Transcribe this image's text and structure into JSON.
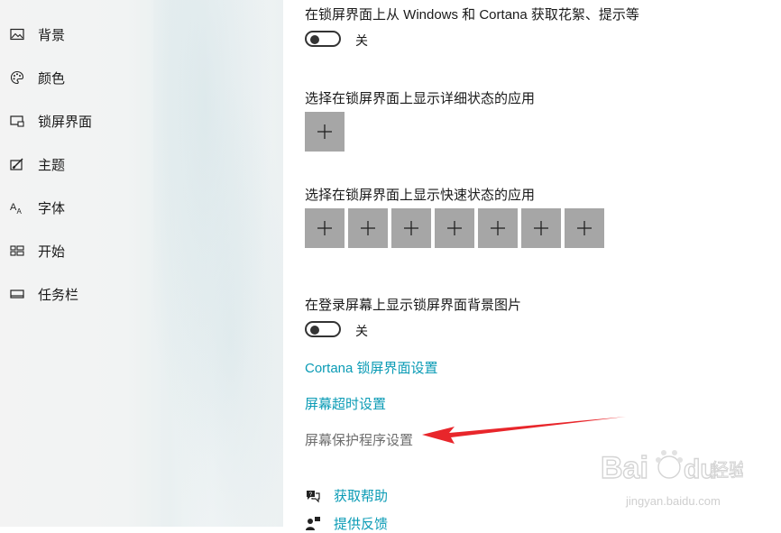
{
  "sidebar": {
    "items": [
      {
        "label": "背景",
        "icon": "image-icon"
      },
      {
        "label": "颜色",
        "icon": "palette-icon"
      },
      {
        "label": "锁屏界面",
        "icon": "lock-screen-icon"
      },
      {
        "label": "主题",
        "icon": "theme-brush-icon"
      },
      {
        "label": "字体",
        "icon": "font-icon"
      },
      {
        "label": "开始",
        "icon": "start-grid-icon"
      },
      {
        "label": "任务栏",
        "icon": "taskbar-icon"
      }
    ]
  },
  "main": {
    "cortana_section": {
      "heading": "在锁屏界面上从 Windows 和 Cortana 获取花絮、提示等",
      "toggle_state": "关"
    },
    "detailed_status": {
      "heading": "选择在锁屏界面上显示详细状态的应用",
      "buttons": [
        "+"
      ]
    },
    "quick_status": {
      "heading": "选择在锁屏界面上显示快速状态的应用",
      "buttons": [
        "+",
        "+",
        "+",
        "+",
        "+",
        "+",
        "+"
      ]
    },
    "signin_background": {
      "heading": "在登录屏幕上显示锁屏界面背景图片",
      "toggle_state": "关"
    },
    "links": {
      "cortana_settings": "Cortana 锁屏界面设置",
      "screen_timeout": "屏幕超时设置",
      "screensaver": "屏幕保护程序设置"
    },
    "help": {
      "get_help": "获取帮助",
      "feedback": "提供反馈"
    }
  },
  "watermark": {
    "brand": "Baidu经验",
    "url": "jingyan.baidu.com"
  },
  "colors": {
    "link": "#0a9bb5",
    "button": "#a6a6a6",
    "arrow": "#e8262b"
  }
}
